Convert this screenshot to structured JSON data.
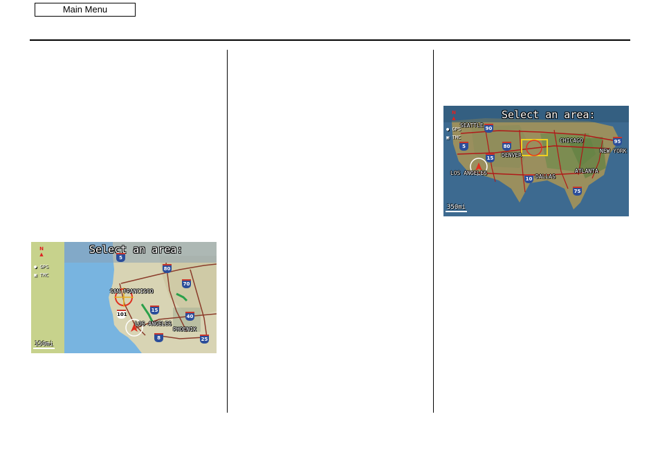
{
  "header": {
    "main_menu_label": "Main Menu"
  },
  "map_west": {
    "title": "Select an area:",
    "north": "N",
    "gps": "GPS",
    "tmc": "TMC",
    "scale": "150mi",
    "cities": [
      "SAN FRANCISCO",
      "LOS ANGELES",
      "PHOENIX"
    ],
    "shields": [
      "5",
      "80",
      "70",
      "15",
      "40",
      "101",
      "8",
      "25"
    ]
  },
  "map_us": {
    "title": "Select an area:",
    "north": "N",
    "gps": "GPS",
    "tmc": "TMC",
    "scale": "350mi",
    "cities": [
      "SEATTLE",
      "DENVER",
      "CHICAGO",
      "NEW YORK",
      "LOS ANGELES",
      "DALLAS",
      "ATLANTA"
    ],
    "shields": [
      "90",
      "5",
      "80",
      "15",
      "95",
      "10",
      "75"
    ]
  }
}
